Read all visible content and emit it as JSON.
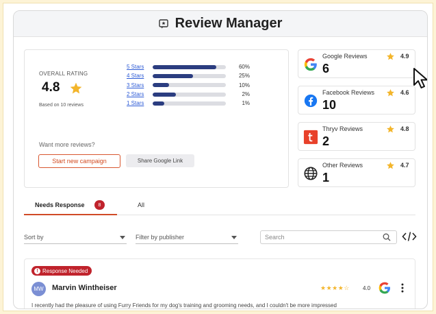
{
  "header": {
    "title": "Review Manager",
    "icon": "review-icon"
  },
  "overall": {
    "label": "OVERALL RATING",
    "value": "4.8",
    "based_on": "Based on 10 reviews",
    "distribution": [
      {
        "label": "5 Stars",
        "percent": 60,
        "percent_label": "60%"
      },
      {
        "label": "4 Stars",
        "percent": 25,
        "percent_label": "25%"
      },
      {
        "label": "3 Stars",
        "percent": 10,
        "percent_label": "10%"
      },
      {
        "label": "2 Stars",
        "percent": 2,
        "percent_label": "2%"
      },
      {
        "label": "1 Stars",
        "percent": 1,
        "percent_label": "1%"
      }
    ],
    "want_more": "Want more reviews?",
    "campaign_button": "Start new campaign",
    "share_button": "Share Google Link"
  },
  "sources": [
    {
      "name": "Google Reviews",
      "count": "6",
      "rating": "4.9",
      "icon": "google-icon"
    },
    {
      "name": "Facebook Reviews",
      "count": "10",
      "rating": "4.6",
      "icon": "facebook-icon"
    },
    {
      "name": "Thryv Reviews",
      "count": "2",
      "rating": "4.8",
      "icon": "thryv-icon"
    },
    {
      "name": "Other Reviews",
      "count": "1",
      "rating": "4.7",
      "icon": "globe-icon"
    }
  ],
  "tabs": {
    "needs_response": "Needs Response",
    "needs_response_count": "8",
    "all": "All"
  },
  "filters": {
    "sort_by": "Sort by",
    "publisher": "Filter by publisher",
    "search_placeholder": "Search"
  },
  "review": {
    "status": "Response Needed",
    "initials": "MW",
    "name": "Marvin Wintheiser",
    "stars": "★★★★☆",
    "rating": "4.0",
    "text": "I recently had the pleasure of using Furry Friends for my dog's training and grooming needs, and I couldn't be more impressed"
  },
  "colors": {
    "accent": "#d04a26",
    "bar": "#2b3d80",
    "star": "#f3b52b",
    "badge": "#c0232c",
    "link": "#2d5bd6"
  }
}
